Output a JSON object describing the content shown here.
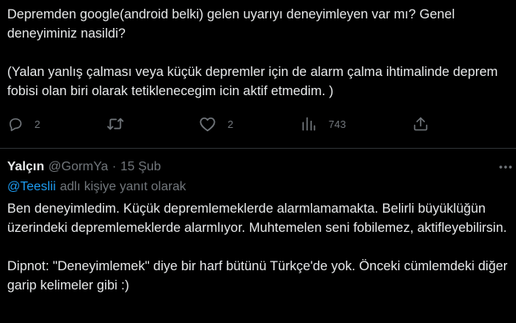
{
  "tweet": {
    "text": "Depremden google(android belki) gelen uyarıyı deneyimleyen var mı? Genel deneyiminiz nasildi?\n\n(Yalan yanlış çalması veya küçük depremler için de alarm çalma ihtimalinde deprem fobisi olan biri olarak tetiklenecegim icin aktif etmedim. )",
    "actions": {
      "reply_count": "2",
      "retweet_count": "",
      "like_count": "2",
      "views_count": "743"
    }
  },
  "reply": {
    "display_name": "Yalçın",
    "handle": "@GormYa",
    "separator": "·",
    "timestamp": "15 Şub",
    "replying_to_mention": "@Teeslii",
    "replying_to_suffix": "adlı kişiye yanıt olarak",
    "text": "Ben deneyimledim. Küçük depremlemeklerde alarmlamamakta. Belirli büyüklüğün üzerindeki depremlemeklerde alarmlıyor. Muhtemelen seni fobilemez, aktifleyebilirsin.\n\nDipnot: \"Deneyimlemek\" diye bir harf bütünü Türkçe'de yok. Önceki cümlemdeki diğer garip kelimeler gibi :)"
  },
  "icons": {
    "reply": "speech-bubble-icon",
    "retweet": "retweet-icon",
    "like": "heart-icon",
    "views": "bar-chart-icon",
    "share": "share-upload-icon",
    "more": "more-dots-icon"
  },
  "colors": {
    "background": "#000000",
    "text": "#e7e9ea",
    "muted": "#71767b",
    "link": "#1d9bf0",
    "divider": "#2f3336"
  }
}
